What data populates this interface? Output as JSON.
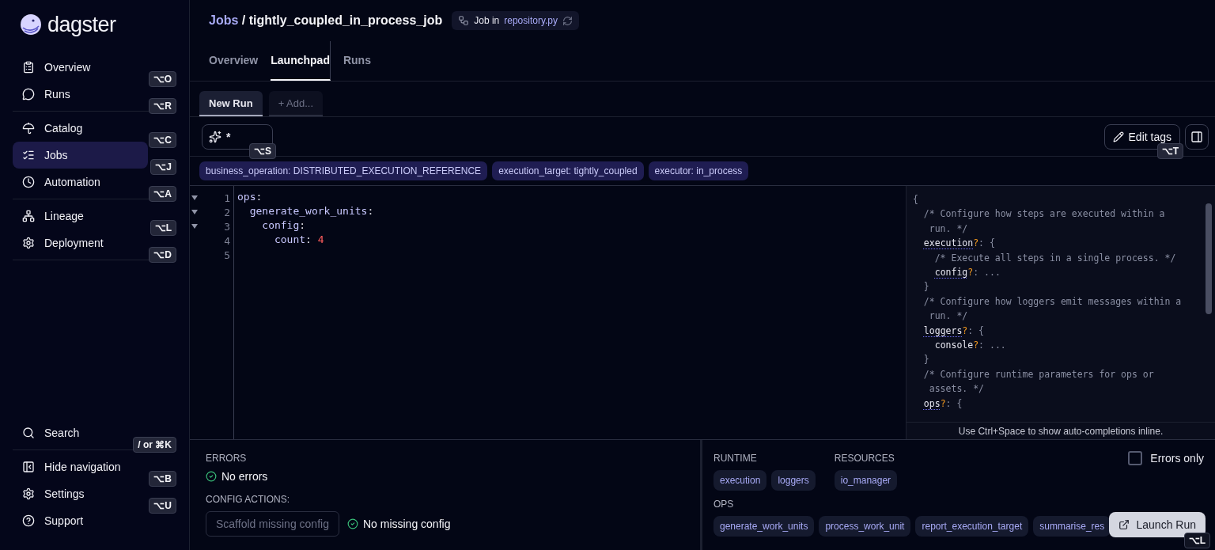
{
  "brand": {
    "name": "dagster"
  },
  "nav_groups": [
    [
      {
        "label": "Overview",
        "shortcut": "⌥O",
        "selected": false
      },
      {
        "label": "Runs",
        "shortcut": "⌥R",
        "selected": false
      }
    ],
    [
      {
        "label": "Catalog",
        "shortcut": "⌥C",
        "selected": false
      },
      {
        "label": "Jobs",
        "shortcut": "⌥J",
        "selected": true
      },
      {
        "label": "Automation",
        "shortcut": "⌥A",
        "selected": false
      }
    ],
    [
      {
        "label": "Lineage",
        "shortcut": "⌥L",
        "selected": false
      },
      {
        "label": "Deployment",
        "shortcut": "⌥D",
        "selected": false
      }
    ]
  ],
  "nav_bottom": [
    [
      {
        "label": "Search",
        "shortcut": "/ or ⌘K",
        "selected": false
      }
    ],
    [
      {
        "label": "Hide navigation",
        "shortcut": "⌥B",
        "selected": false
      },
      {
        "label": "Settings",
        "shortcut": "⌥U",
        "selected": false
      },
      {
        "label": "Support",
        "selected": false
      }
    ]
  ],
  "breadcrumb": {
    "parent": "Jobs",
    "separator": "/",
    "current": "tightly_coupled_in_process_job"
  },
  "job_badge": {
    "prefix": "Job in",
    "link": "repository.py"
  },
  "tabs": [
    {
      "label": "Overview",
      "selected": false
    },
    {
      "label": "Launchpad",
      "selected": true
    },
    {
      "label": "Runs",
      "selected": false
    }
  ],
  "run_tabs": [
    {
      "label": "New Run",
      "selected": true
    },
    {
      "label": "+ Add...",
      "selected": false
    }
  ],
  "op_selector": {
    "value": "*",
    "shortcut": "⌥S"
  },
  "edit_tags": {
    "label": "Edit tags",
    "shortcut": "⌥T"
  },
  "tags": [
    "business_operation: DISTRIBUTED_EXECUTION_REFERENCE",
    "execution_target: tightly_coupled",
    "executor: in_process"
  ],
  "editor_lines": [
    {
      "number": "1",
      "foldable": true,
      "text": "ops:"
    },
    {
      "number": "2",
      "foldable": true,
      "text": "  generate_work_units:"
    },
    {
      "number": "3",
      "foldable": true,
      "text": "    config:"
    },
    {
      "number": "4",
      "foldable": false,
      "text": "      count: 4"
    },
    {
      "number": "5",
      "foldable": false
    }
  ],
  "schema_lines": [
    {
      "kind": "brace",
      "text": "{"
    },
    {
      "kind": "comment",
      "text": "  /* Configure how steps are executed within a"
    },
    {
      "kind": "comment",
      "text": "   run. */"
    },
    {
      "kind": "key",
      "text": "  execution?: {"
    },
    {
      "kind": "comment",
      "text": "    /* Execute all steps in a single process. */"
    },
    {
      "kind": "key",
      "text": "    config?: ..."
    },
    {
      "kind": "brace",
      "text": "  }"
    },
    {
      "kind": "comment",
      "text": "  /* Configure how loggers emit messages within a"
    },
    {
      "kind": "comment",
      "text": "   run. */"
    },
    {
      "kind": "key",
      "text": "  loggers?: {"
    },
    {
      "kind": "plain",
      "text": "    console?: ..."
    },
    {
      "kind": "brace",
      "text": "  }"
    },
    {
      "kind": "comment",
      "text": "  /* Configure runtime parameters for ops or"
    },
    {
      "kind": "comment",
      "text": "   assets. */"
    },
    {
      "kind": "key",
      "text": "  ops?: {"
    }
  ],
  "schema_hint": "Use Ctrl+Space to show auto-completions inline.",
  "errors": {
    "heading": "ERRORS",
    "status": "No errors"
  },
  "config_actions": {
    "heading": "CONFIG ACTIONS:",
    "button": "Scaffold missing config",
    "status": "No missing config"
  },
  "sections": [
    {
      "heading": "RUNTIME",
      "items": [
        "execution",
        "loggers"
      ]
    },
    {
      "heading": "RESOURCES",
      "items": [
        "io_manager"
      ]
    }
  ],
  "ops": {
    "heading": "OPS",
    "items": [
      "generate_work_units",
      "process_work_unit",
      "report_execution_target",
      "summarise_res"
    ]
  },
  "errors_only": {
    "label": "Errors only",
    "checked": false
  },
  "launch": {
    "label": "Launch Run",
    "shortcut": "⌥L"
  }
}
